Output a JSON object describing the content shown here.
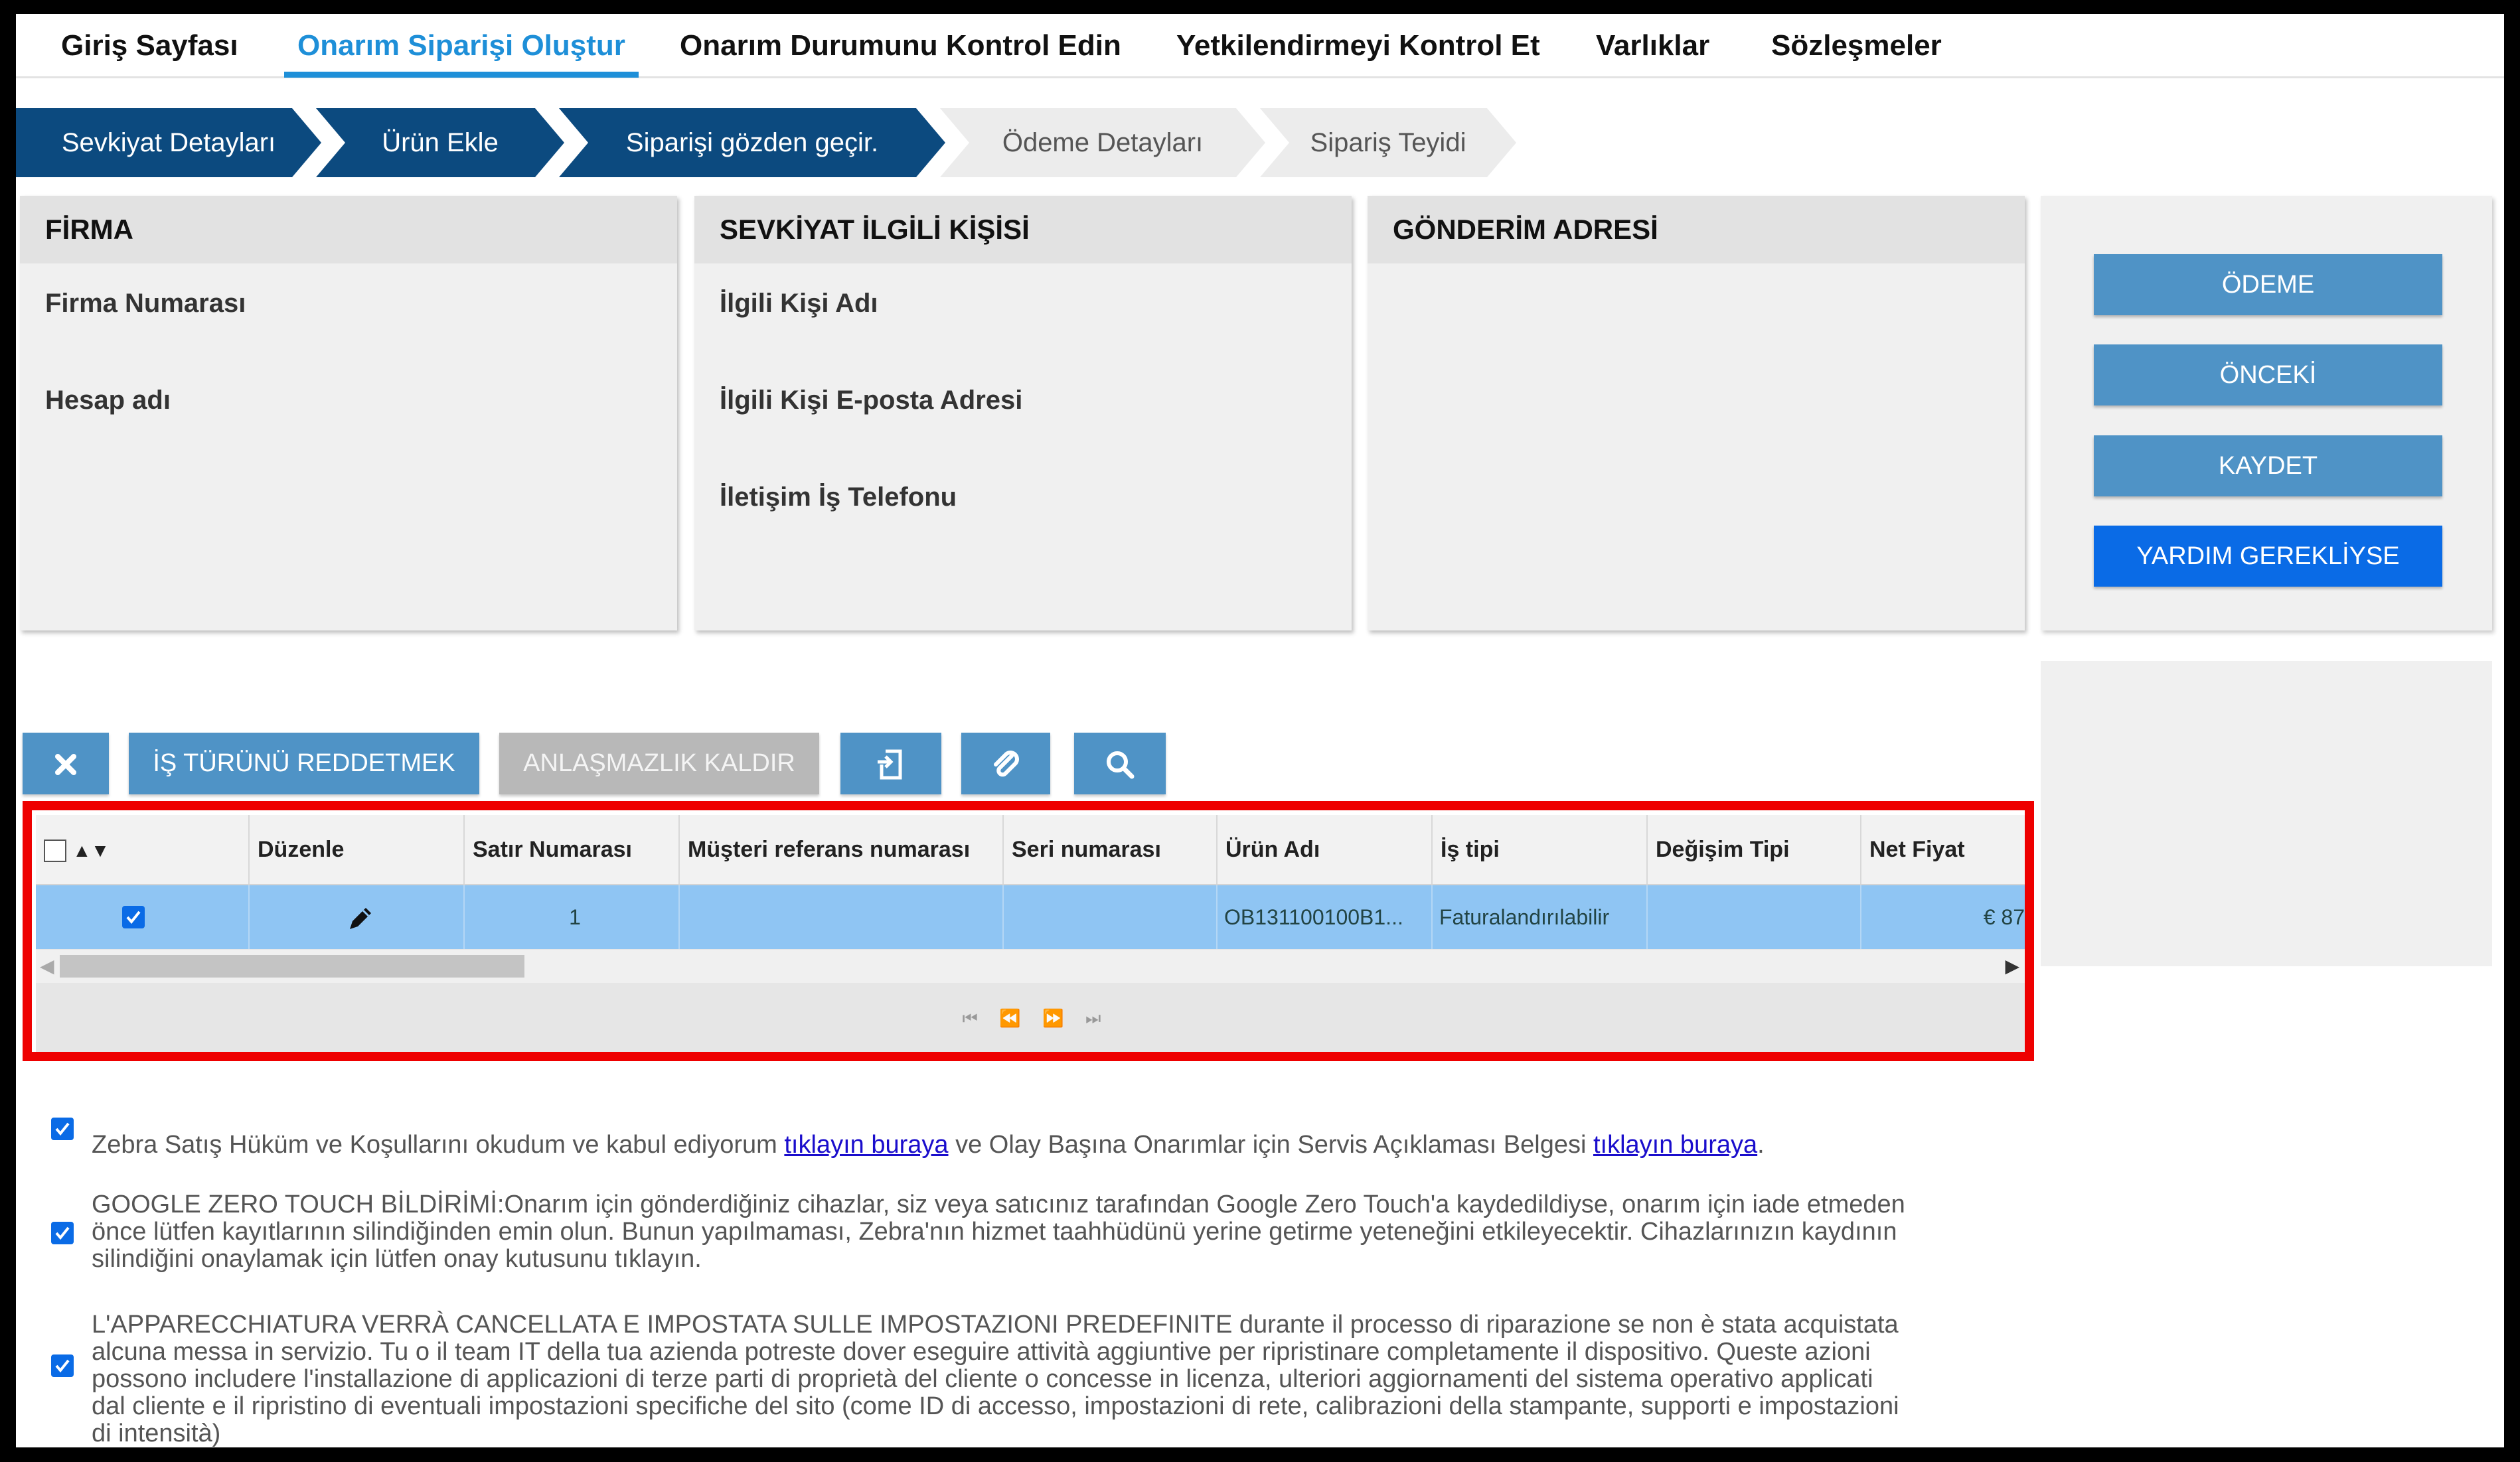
{
  "nav": {
    "tabs": [
      "Giriş Sayfası",
      "Onarım Siparişi Oluştur",
      "Onarım Durumunu Kontrol Edin",
      "Yetkilendirmeyi Kontrol Et",
      "Varlıklar",
      "Sözleşmeler"
    ],
    "active_tab": "Onarım Siparişi Oluştur"
  },
  "steps": [
    "Sevkiyat Detayları",
    "Ürün Ekle",
    "Siparişi gözden geçir.",
    "Ödeme Detayları",
    "Sipariş Teyidi"
  ],
  "panels": {
    "firma": {
      "title": "FİRMA",
      "fields": [
        "Firma Numarası",
        "Hesap adı"
      ]
    },
    "contact": {
      "title": "SEVKİYAT İLGİLİ KİŞİSİ",
      "fields": [
        "İlgili Kişi Adı",
        "İlgili Kişi E-posta Adresi",
        "İletişim İş Telefonu"
      ]
    },
    "address": {
      "title": "GÖNDERİM ADRESİ"
    }
  },
  "side_buttons": {
    "payment": "ÖDEME",
    "previous": "ÖNCEKİ",
    "save": "KAYDET",
    "help": "YARDIM GEREKLİYSE"
  },
  "toolbar": {
    "reject_job_type": "İŞ TÜRÜNÜ REDDETMEK",
    "remove_dispute": "ANLAŞMAZLIK KALDIR"
  },
  "grid": {
    "columns": [
      "Düzenle",
      "Satır Numarası",
      "Müşteri referans numarası",
      "Seri numarası",
      "Ürün Adı",
      "İş tipi",
      "Değişim Tipi",
      "Net Fiyat"
    ],
    "row": {
      "line_number": "1",
      "customer_ref": "",
      "serial": "",
      "product_name": "OB131100100B1...",
      "job_type": "Faturalandırılabilir",
      "exchange_type": "",
      "net_price": "€ 87"
    }
  },
  "terms": {
    "t1_a": "Zebra Satış Hüküm ve Koşullarını okudum ve kabul ediyorum ",
    "t1_link1": "tıklayın buraya",
    "t1_b": " ve Olay Başına Onarımlar için Servis Açıklaması Belgesi ",
    "t1_link2": "tıklayın buraya",
    "t1_c": ".",
    "t2_l1": "GOOGLE ZERO TOUCH BİLDİRİMİ:Onarım için gönderdiğiniz cihazlar, siz veya satıcınız tarafından Google Zero Touch'a kaydedildiyse, onarım için iade etmeden",
    "t2_l2": "önce lütfen kayıtlarının silindiğinden emin olun. Bunun yapılmaması, Zebra'nın hizmet taahhüdünü yerine getirme yeteneğini etkileyecektir. Cihazlarınızın kaydının",
    "t2_l3": "silindiğini onaylamak için lütfen onay kutusunu tıklayın.",
    "t3_l1": "L'APPARECCHIATURA VERRÀ CANCELLATA E IMPOSTATA SULLE IMPOSTAZIONI PREDEFINITE durante il processo di riparazione se non è stata acquistata",
    "t3_l2": "alcuna messa in servizio. Tu o il team IT della tua azienda potreste dover eseguire attività aggiuntive per ripristinare completamente il dispositivo. Queste azioni",
    "t3_l3": "possono includere l'installazione di applicazioni di terze parti di proprietà del cliente o concesse in licenza, ulteriori aggiornamenti del sistema operativo applicati",
    "t3_l4": "dal cliente e il ripristino di eventuali impostazioni specifiche del sito (come ID di accesso, impostazioni di rete, calibrazioni della stampante, supporti e impostazioni",
    "t3_l5": "di intensità)"
  },
  "colors": {
    "accent": "#1e8fd8",
    "step_done": "#0c4a7f",
    "button": "#4f93c6",
    "help_button": "#0a6be6",
    "highlight_row": "#8fc5f3",
    "annotation_red": "#ee0000"
  }
}
